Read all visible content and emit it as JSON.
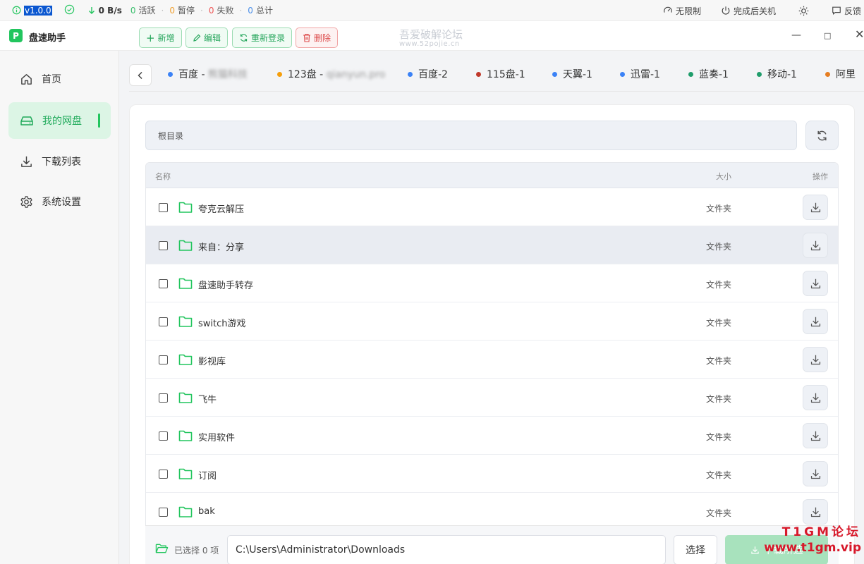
{
  "statusbar": {
    "version": "v1.0.0",
    "speed": "0 B/s",
    "active_count": "0",
    "active_label": "活跃",
    "paused_count": "0",
    "paused_label": "暂停",
    "failed_count": "0",
    "failed_label": "失败",
    "total_count": "0",
    "total_label": "总计",
    "speed_limit_label": "无限制",
    "shutdown_label": "完成后关机",
    "feedback_label": "反馈"
  },
  "titlebar": {
    "logo_letter": "P",
    "app_name": "盘速助手",
    "new_label": "新增",
    "edit_label": "编辑",
    "relogin_label": "重新登录",
    "delete_label": "删除",
    "watermark_line1": "吾爱破解论坛",
    "watermark_line2": "www.52pojie.cn"
  },
  "sidebar": {
    "items": [
      {
        "label": "首页",
        "icon": "home-icon"
      },
      {
        "label": "我的网盘",
        "icon": "drive-icon"
      },
      {
        "label": "下载列表",
        "icon": "download-icon"
      },
      {
        "label": "系统设置",
        "icon": "gear-icon"
      }
    ],
    "active": "我的网盘"
  },
  "tabs": [
    {
      "prefix": "百度 - ",
      "masked": "熊猫科技",
      "color": "#3b82f6"
    },
    {
      "prefix": "123盘 - ",
      "masked": "qianyun.pro",
      "color": "#f59e0b"
    },
    {
      "prefix": "百度-2",
      "masked": "",
      "color": "#3b82f6"
    },
    {
      "prefix": "115盘-1",
      "masked": "",
      "color": "#c0392b"
    },
    {
      "prefix": "天翼-1",
      "masked": "",
      "color": "#3b82f6"
    },
    {
      "prefix": "迅雷-1",
      "masked": "",
      "color": "#3b82f6"
    },
    {
      "prefix": "蓝奏-1",
      "masked": "",
      "color": "#1f9d6b"
    },
    {
      "prefix": "移动-1",
      "masked": "",
      "color": "#1f9d6b"
    },
    {
      "prefix": "阿里",
      "masked": "",
      "color": "#e67e22"
    }
  ],
  "browser": {
    "path": "根目录",
    "col_name": "名称",
    "col_size": "大小",
    "col_op": "操作",
    "rows": [
      {
        "name": "夸克云解压",
        "size": "文件夹"
      },
      {
        "name": "来自：分享",
        "size": "文件夹"
      },
      {
        "name": "盘速助手转存",
        "size": "文件夹"
      },
      {
        "name": "switch游戏",
        "size": "文件夹"
      },
      {
        "name": "影视库",
        "size": "文件夹"
      },
      {
        "name": "飞牛",
        "size": "文件夹"
      },
      {
        "name": "实用软件",
        "size": "文件夹"
      },
      {
        "name": "订阅",
        "size": "文件夹"
      },
      {
        "name": "bak",
        "size": "文件夹"
      }
    ],
    "highlighted_row": 1
  },
  "footer": {
    "selected_text": "已选择 0 项",
    "download_path": "C:\\Users\\Administrator\\Downloads",
    "choose_label": "选择",
    "start_label": "下载所选"
  },
  "forum_mark": {
    "line1": "T1GM论坛",
    "line2": "www.t1gm.vip"
  },
  "colors": {
    "accent": "#22c55e",
    "danger": "#dd4b4b",
    "version_bg": "#0b57d0"
  }
}
